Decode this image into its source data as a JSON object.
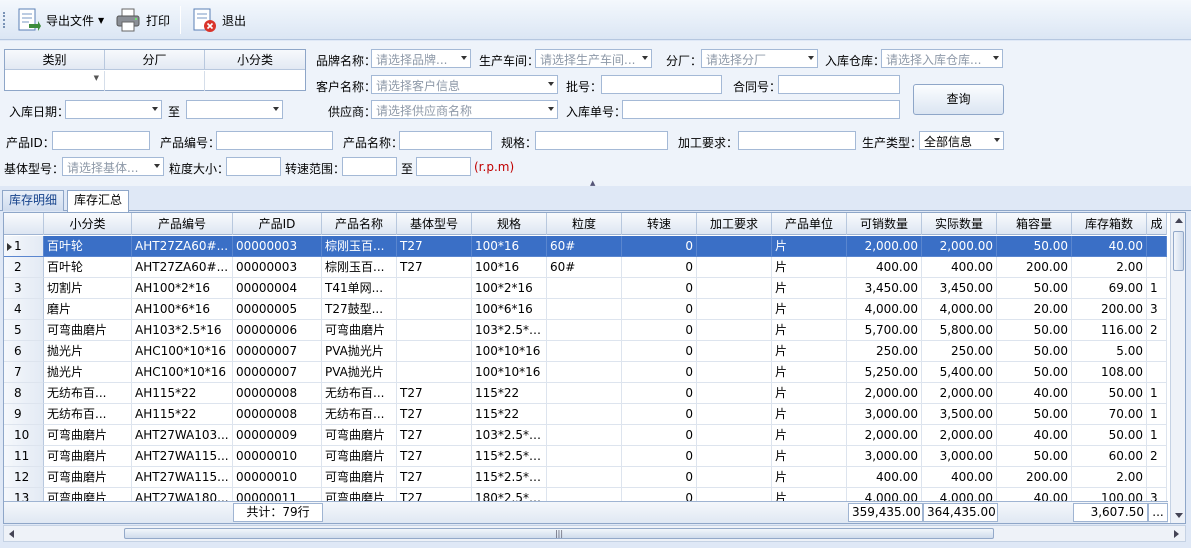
{
  "toolbar": {
    "export_label": "导出文件",
    "print_label": "打印",
    "exit_label": "退出"
  },
  "filter": {
    "cat_headers": [
      "类别",
      "分厂",
      "小分类"
    ],
    "brand_label": "品牌名称：",
    "brand_ph": "请选择品牌...",
    "workshop_label": "生产车间：",
    "workshop_ph": "请选择生产车间...",
    "branch_label": "分厂：",
    "branch_ph": "请选择分厂",
    "warehouse_label": "入库仓库：",
    "warehouse_ph": "请选择入库仓库...",
    "customer_label": "客户名称：",
    "customer_ph": "请选择客户信息",
    "batch_label": "批号：",
    "contract_label": "合同号：",
    "indate_label": "入库日期：",
    "to_label": "至",
    "supplier_label": "供应商：",
    "supplier_ph": "请选择供应商名称",
    "inorder_label": "入库单号：",
    "query_label": "查询",
    "pid_label": "产品ID：",
    "pcode_label": "产品编号：",
    "pname_label": "产品名称：",
    "spec_label": "规格：",
    "proc_label": "加工要求：",
    "ptype_label": "生产类型：",
    "ptype_value": "全部信息",
    "base_label": "基体型号：",
    "base_ph": "请选择基体...",
    "grain_label": "粒度大小：",
    "speed_label": "转速范围：",
    "speed_to": "至",
    "rpm": "(r.p.m)"
  },
  "tabs": [
    "库存明细",
    "库存汇总"
  ],
  "grid": {
    "headers": [
      "",
      "小分类",
      "产品编号",
      "产品ID",
      "产品名称",
      "基体型号",
      "规格",
      "粒度",
      "转速",
      "加工要求",
      "产品单位",
      "可销数量",
      "实际数量",
      "箱容量",
      "库存箱数",
      "成"
    ],
    "rows": [
      [
        "1",
        "百叶轮",
        "AHT27ZA60#...",
        "00000003",
        "棕刚玉百...",
        "T27",
        "100*16",
        "60#",
        "0",
        "",
        "片",
        "2,000.00",
        "2,000.00",
        "50.00",
        "40.00",
        ""
      ],
      [
        "2",
        "百叶轮",
        "AHT27ZA60#...",
        "00000003",
        "棕刚玉百...",
        "T27",
        "100*16",
        "60#",
        "0",
        "",
        "片",
        "400.00",
        "400.00",
        "200.00",
        "2.00",
        ""
      ],
      [
        "3",
        "切割片",
        "AH100*2*16",
        "00000004",
        "T41单网...",
        "",
        "100*2*16",
        "",
        "0",
        "",
        "片",
        "3,450.00",
        "3,450.00",
        "50.00",
        "69.00",
        "1"
      ],
      [
        "4",
        "磨片",
        "AH100*6*16",
        "00000005",
        "T27鼓型...",
        "",
        "100*6*16",
        "",
        "0",
        "",
        "片",
        "4,000.00",
        "4,000.00",
        "20.00",
        "200.00",
        "3"
      ],
      [
        "5",
        "可弯曲磨片",
        "AH103*2.5*16",
        "00000006",
        "可弯曲磨片",
        "",
        "103*2.5*16",
        "",
        "0",
        "",
        "片",
        "5,700.00",
        "5,800.00",
        "50.00",
        "116.00",
        "2"
      ],
      [
        "6",
        "抛光片",
        "AHC100*10*16",
        "00000007",
        "PVA抛光片",
        "",
        "100*10*16",
        "",
        "0",
        "",
        "片",
        "250.00",
        "250.00",
        "50.00",
        "5.00",
        ""
      ],
      [
        "7",
        "抛光片",
        "AHC100*10*16",
        "00000007",
        "PVA抛光片",
        "",
        "100*10*16",
        "",
        "0",
        "",
        "片",
        "5,250.00",
        "5,400.00",
        "50.00",
        "108.00",
        ""
      ],
      [
        "8",
        "无纺布百...",
        "AH115*22",
        "00000008",
        "无纺布百...",
        "T27",
        "115*22",
        "",
        "0",
        "",
        "片",
        "2,000.00",
        "2,000.00",
        "40.00",
        "50.00",
        "1"
      ],
      [
        "9",
        "无纺布百...",
        "AH115*22",
        "00000008",
        "无纺布百...",
        "T27",
        "115*22",
        "",
        "0",
        "",
        "片",
        "3,000.00",
        "3,500.00",
        "50.00",
        "70.00",
        "1"
      ],
      [
        "10",
        "可弯曲磨片",
        "AHT27WA103...",
        "00000009",
        "可弯曲磨片",
        "T27",
        "103*2.5*16",
        "",
        "0",
        "",
        "片",
        "2,000.00",
        "2,000.00",
        "40.00",
        "50.00",
        "1"
      ],
      [
        "11",
        "可弯曲磨片",
        "AHT27WA115...",
        "00000010",
        "可弯曲磨片",
        "T27",
        "115*2.5*22",
        "",
        "0",
        "",
        "片",
        "3,000.00",
        "3,000.00",
        "50.00",
        "60.00",
        "2"
      ],
      [
        "12",
        "可弯曲磨片",
        "AHT27WA115...",
        "00000010",
        "可弯曲磨片",
        "T27",
        "115*2.5*22",
        "",
        "0",
        "",
        "片",
        "400.00",
        "400.00",
        "200.00",
        "2.00",
        ""
      ],
      [
        "13",
        "可弯曲磨片",
        "AHT27WA180...",
        "00000011",
        "可弯曲磨片",
        "T27",
        "180*2.5*22",
        "",
        "0",
        "",
        "片",
        "4,000.00",
        "4,000.00",
        "40.00",
        "100.00",
        "3"
      ]
    ],
    "footer": {
      "count": "共计：79行",
      "sale_total": "359,435.00",
      "actual_total": "364,435.00",
      "box_total": "3,607.50",
      "more": "..."
    }
  },
  "colors": {
    "selected_row": "#3a6fc6",
    "rpm": "#c00000"
  }
}
